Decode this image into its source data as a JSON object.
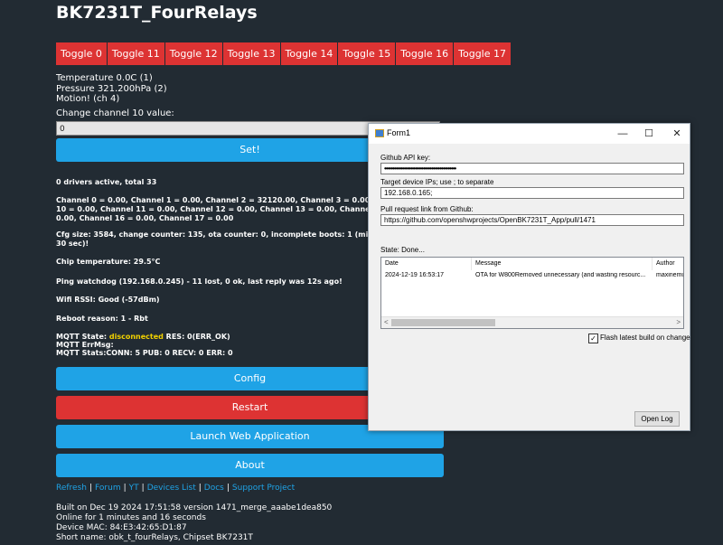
{
  "page": {
    "title": "BK7231T_FourRelays",
    "toggles": [
      "Toggle 0",
      "Toggle 11",
      "Toggle 12",
      "Toggle 13",
      "Toggle 14",
      "Toggle 15",
      "Toggle 16",
      "Toggle 17"
    ],
    "sensors": [
      "Temperature 0.0C (1)",
      "Pressure 321.200hPa (2)",
      "Motion! (ch 4)",
      "Change channel 10 value:"
    ],
    "channel_value": "0",
    "set_button": "Set!",
    "drivers": "0 drivers active, total 33",
    "channels_line1": "Channel 0 = 0.00, Channel 1 = 0.00, Channel 2 = 32120.00, Channel 3 = 0.00, Channel",
    "channels_line2": "10 = 0.00, Channel 11 = 0.00, Channel 12 = 0.00, Channel 13 = 0.00, Channel 14 = 0.",
    "channels_line3": "0.00, Channel 16 = 0.00, Channel 17 = 0.00",
    "cfg_line1": "Cfg size: 3584, change counter: 135, ota counter: 0, incomplete boots: 1 (might chang",
    "cfg_line2": "30 sec)!",
    "chip_temp": "Chip temperature: 29.5°C",
    "ping": "Ping watchdog (192.168.0.245) - 11 lost, 0 ok, last reply was 12s ago!",
    "wifi": "Wifi RSSI: Good (-57dBm)",
    "reboot": "Reboot reason: 1 - Rbt",
    "mqtt_state_prefix": "MQTT State: ",
    "mqtt_state": "disconnected",
    "mqtt_state_suffix": " RES: 0(ERR_OK)",
    "mqtt_err": "MQTT ErrMsg:",
    "mqtt_stats": "MQTT Stats:CONN: 5 PUB: 0 RECV: 0 ERR: 0",
    "buttons": {
      "config": "Config",
      "restart": "Restart",
      "launch": "Launch Web Application",
      "about": "About"
    },
    "links": [
      "Refresh",
      "Forum",
      "YT",
      "Devices List",
      "Docs",
      "Support Project"
    ],
    "link_sep": "|",
    "footer": [
      "Built on Dec 19 2024 17:51:58 version 1471_merge_aaabe1dea850",
      "Online for 1 minutes and 16 seconds",
      "Device MAC: 84:E3:42:65:D1:87",
      "Short name: obk_t_fourRelays, Chipset BK7231T"
    ]
  },
  "form": {
    "title": "Form1",
    "minimize": "—",
    "maximize": "☐",
    "close": "✕",
    "api_key_label": "Github API key:",
    "api_key_value": "••••••••••••••••••••••••••••••••••••••••••••",
    "ips_label": "Target device IPs; use ; to separate",
    "ips_value": "192.168.0.165;",
    "pr_label": "Pull request link from Github:",
    "pr_value": "https://github.com/openshwprojects/OpenBK7231T_App/pull/1471",
    "state": "State: Done...",
    "columns": [
      "Date",
      "Message",
      "Author"
    ],
    "row": {
      "date": "2024-12-19 16:53:17",
      "message": "OTA for W800Removed unnecessary (and wasting resourc...",
      "author": "maxinemu"
    },
    "checkbox_label": "Flash latest build on change",
    "checkbox_checked": true,
    "checkmark": "✓",
    "open_log": "Open Log",
    "scroll_left": "<",
    "scroll_right": ">"
  }
}
